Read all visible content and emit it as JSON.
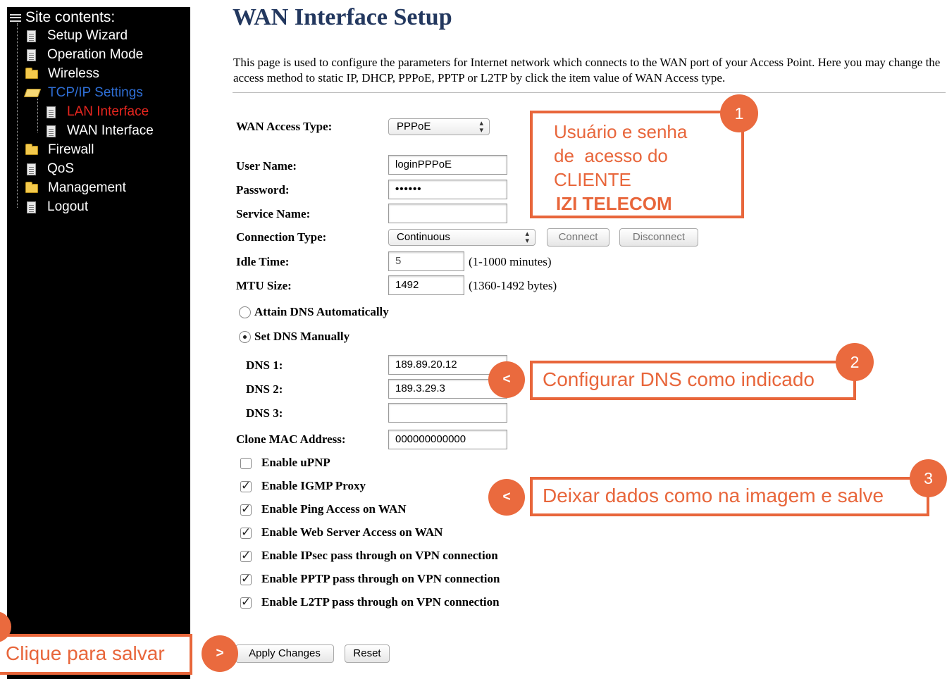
{
  "sidebar": {
    "title": "Site contents:",
    "items": [
      {
        "label": "Setup Wizard",
        "icon": "page-icon"
      },
      {
        "label": "Operation Mode",
        "icon": "page-icon"
      },
      {
        "label": "Wireless",
        "icon": "folder-icon"
      },
      {
        "label": "TCP/IP Settings",
        "icon": "open-folder-icon"
      },
      {
        "label": "LAN Interface",
        "icon": "page-icon"
      },
      {
        "label": "WAN Interface",
        "icon": "page-icon"
      },
      {
        "label": "Firewall",
        "icon": "folder-icon"
      },
      {
        "label": "QoS",
        "icon": "page-icon"
      },
      {
        "label": "Management",
        "icon": "folder-icon"
      },
      {
        "label": "Logout",
        "icon": "page-icon"
      }
    ],
    "colors": {
      "selected": "#2f6fd6",
      "active": "#e8261f",
      "text": "#ffffff"
    }
  },
  "page": {
    "title": "WAN Interface Setup",
    "description": "This page is used to configure the parameters for Internet network which connects to the WAN port of your Access Point. Here you may change the access method to static IP, DHCP, PPPoE, PPTP or L2TP by click the item value of WAN Access type."
  },
  "form": {
    "wan_access_type": {
      "label": "WAN Access Type:",
      "value": "PPPoE"
    },
    "user_name": {
      "label": "User Name:",
      "value": "loginPPPoE"
    },
    "password": {
      "label": "Password:",
      "value": "••••••"
    },
    "service_name": {
      "label": "Service Name:",
      "value": ""
    },
    "connection_type": {
      "label": "Connection Type:",
      "value": "Continuous"
    },
    "connect_label": "Connect",
    "disconnect_label": "Disconnect",
    "idle_time": {
      "label": "Idle Time:",
      "value": "5",
      "hint": "(1-1000 minutes)"
    },
    "mtu_size": {
      "label": "MTU Size:",
      "value": "1492",
      "hint": "(1360-1492 bytes)"
    },
    "dns_auto_label": "Attain DNS Automatically",
    "dns_manual_label": "Set DNS Manually",
    "dns1": {
      "label": "DNS 1:",
      "value": "189.89.20.12"
    },
    "dns2": {
      "label": "DNS 2:",
      "value": "189.3.29.3"
    },
    "dns3": {
      "label": "DNS 3:",
      "value": ""
    },
    "clone_mac": {
      "label": "Clone MAC Address:",
      "value": "000000000000"
    },
    "checkboxes": [
      {
        "label": "Enable uPNP",
        "checked": false
      },
      {
        "label": "Enable IGMP Proxy",
        "checked": true
      },
      {
        "label": "Enable Ping Access on WAN",
        "checked": true
      },
      {
        "label": "Enable Web Server Access on WAN",
        "checked": true
      },
      {
        "label": "Enable IPsec pass through on VPN connection",
        "checked": true
      },
      {
        "label": "Enable PPTP pass through on VPN connection",
        "checked": true
      },
      {
        "label": "Enable L2TP pass through on VPN connection",
        "checked": true
      }
    ],
    "apply_label": "Apply Changes",
    "reset_label": "Reset"
  },
  "annotations": {
    "callout1": {
      "badge": "1",
      "line1": "Usuário e senha",
      "line2": "de  acesso do",
      "line3": "CLIENTE",
      "line4": "IZI TELECOM"
    },
    "callout2": {
      "badge": "2",
      "arrow": "<",
      "text": "Configurar DNS como indicado"
    },
    "callout3": {
      "badge": "3",
      "arrow": "<",
      "text": "Deixar dados como na imagem e salve"
    },
    "callout4": {
      "arrow": ">",
      "text": "Clique para salvar"
    },
    "accent_color": "#e8663b"
  }
}
